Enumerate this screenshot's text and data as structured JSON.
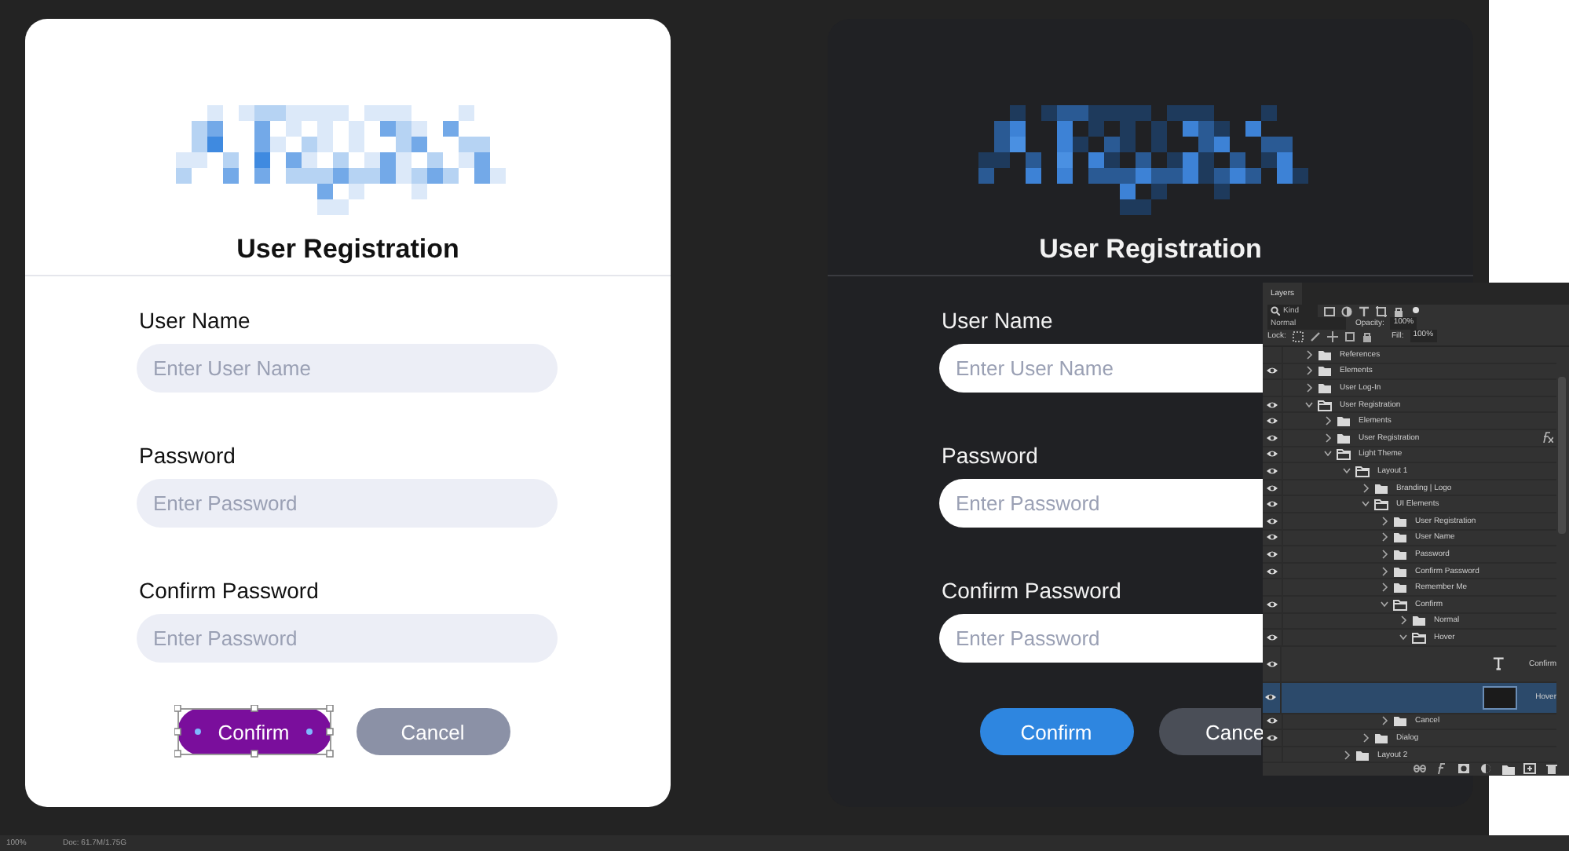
{
  "cards": [
    {
      "dark": false,
      "title": "User Registration",
      "fields": [
        {
          "label": "User Name",
          "placeholder": "Enter User Name"
        },
        {
          "label": "Password",
          "placeholder": "Enter Password"
        },
        {
          "label": "Confirm Password",
          "placeholder": "Enter Password"
        }
      ],
      "confirm": {
        "label": "Confirm",
        "hover": true,
        "transform_selected": true
      },
      "cancel": {
        "label": "Cancel"
      }
    },
    {
      "dark": true,
      "title": "User Registration",
      "fields": [
        {
          "label": "User Name",
          "placeholder": "Enter User Name"
        },
        {
          "label": "Password",
          "placeholder": "Enter Password"
        },
        {
          "label": "Confirm Password",
          "placeholder": "Enter Password"
        }
      ],
      "confirm": {
        "label": "Confirm",
        "hover": false,
        "transform_selected": false
      },
      "cancel": {
        "label": "Cance"
      }
    }
  ],
  "layers_panel": {
    "tab": "Layers",
    "filter": "Kind",
    "blend_mode": "Normal",
    "opacity_label": "Opacity:",
    "opacity": "100%",
    "lock_label": "Lock:",
    "fill_label": "Fill:",
    "fill": "100%",
    "layers": [
      {
        "kind": "folder",
        "name": "References",
        "visible": false,
        "expanded": false
      },
      {
        "kind": "folder",
        "name": "Elements",
        "visible": true,
        "expanded": false
      },
      {
        "kind": "folder",
        "name": "User Log-In",
        "visible": false,
        "expanded": false
      },
      {
        "kind": "folder",
        "name": "User Registration",
        "visible": true,
        "expanded": true,
        "children": [
          {
            "kind": "folder",
            "name": "Elements",
            "visible": true,
            "expanded": false
          },
          {
            "kind": "folder",
            "name": "User Registration",
            "visible": true,
            "expanded": false,
            "fx": true
          },
          {
            "kind": "folder",
            "name": "Light Theme",
            "visible": true,
            "expanded": true,
            "children": [
              {
                "kind": "folder",
                "name": "Layout 1",
                "visible": true,
                "expanded": true,
                "children": [
                  {
                    "kind": "folder",
                    "name": "Branding | Logo",
                    "visible": true,
                    "expanded": false
                  },
                  {
                    "kind": "folder",
                    "name": "UI Elements",
                    "visible": true,
                    "expanded": true,
                    "children": [
                      {
                        "kind": "folder",
                        "name": "User Registration",
                        "visible": true,
                        "expanded": false
                      },
                      {
                        "kind": "folder",
                        "name": "User Name",
                        "visible": true,
                        "expanded": false
                      },
                      {
                        "kind": "folder",
                        "name": "Password",
                        "visible": true,
                        "expanded": false
                      },
                      {
                        "kind": "folder",
                        "name": "Confirm Password",
                        "visible": true,
                        "expanded": false
                      },
                      {
                        "kind": "folder",
                        "name": "Remember Me",
                        "visible": false,
                        "expanded": false
                      },
                      {
                        "kind": "folder",
                        "name": "Confirm",
                        "visible": true,
                        "expanded": true,
                        "children": [
                          {
                            "kind": "folder",
                            "name": "Normal",
                            "visible": false,
                            "expanded": false
                          },
                          {
                            "kind": "folder",
                            "name": "Hover",
                            "visible": true,
                            "expanded": true,
                            "children": [
                              {
                                "kind": "text",
                                "name": "Confirm",
                                "visible": true
                              },
                              {
                                "kind": "shape",
                                "name": "Hover",
                                "visible": true,
                                "selected": true
                              }
                            ]
                          }
                        ]
                      },
                      {
                        "kind": "folder",
                        "name": "Cancel",
                        "visible": true,
                        "expanded": false
                      }
                    ]
                  },
                  {
                    "kind": "folder",
                    "name": "Dialog",
                    "visible": true,
                    "expanded": false
                  }
                ]
              },
              {
                "kind": "folder",
                "name": "Layout 2",
                "visible": false,
                "expanded": false
              }
            ]
          }
        ]
      }
    ]
  },
  "status_bar": {
    "zoom": "100%",
    "doc": "Doc: 61.7M/1.75G"
  }
}
